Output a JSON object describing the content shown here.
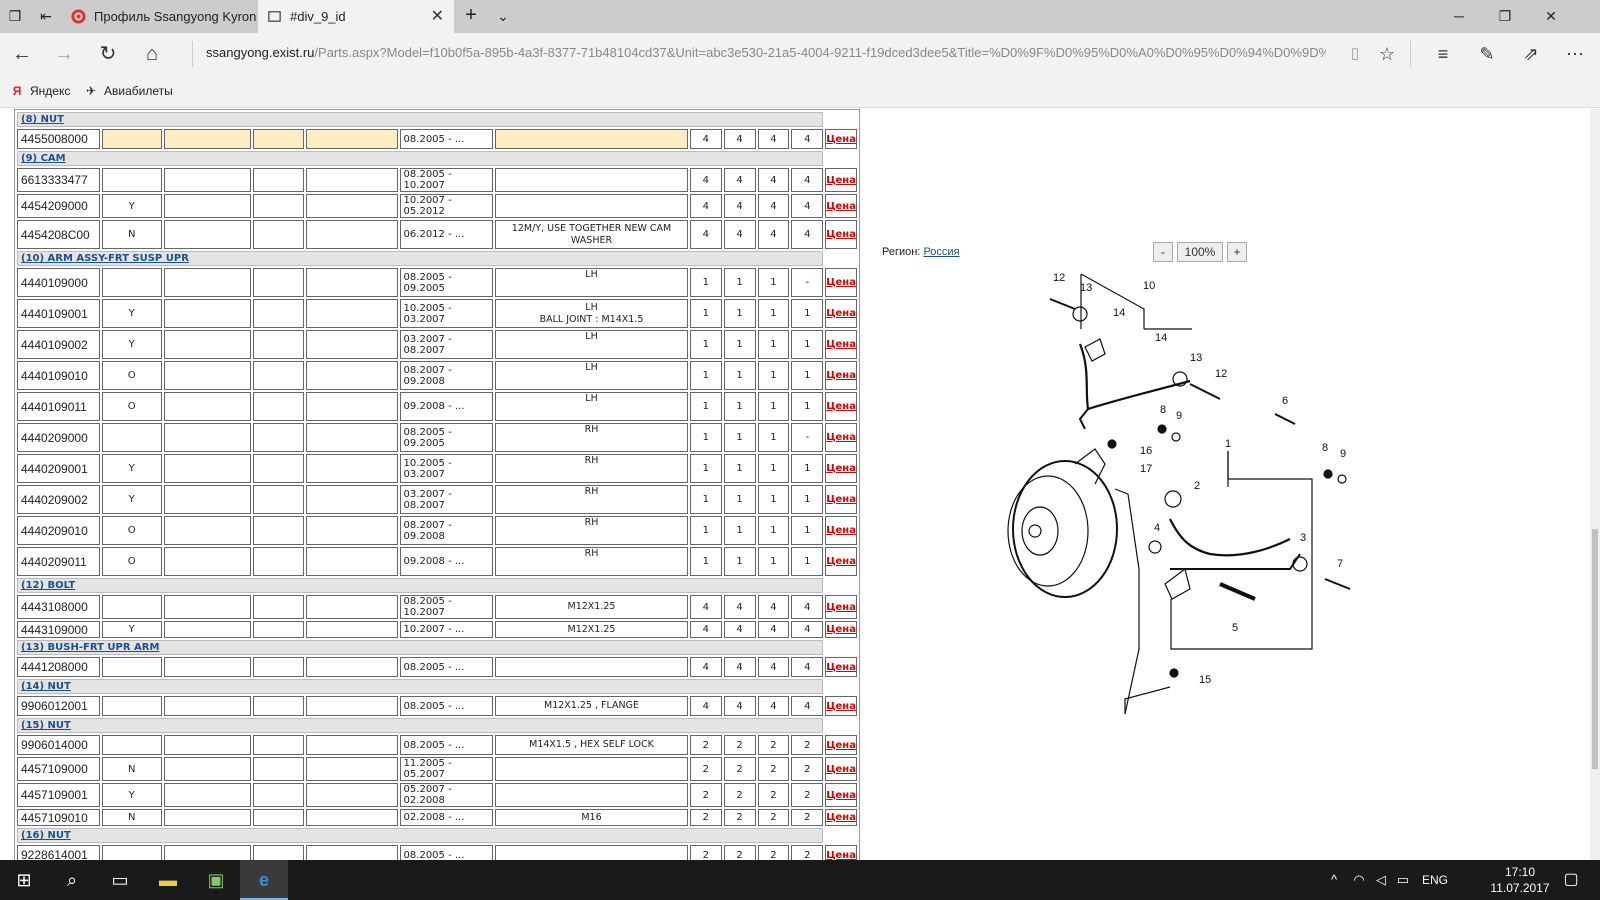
{
  "browser": {
    "tabs": [
      {
        "title": "Профиль Ssangyong Kyron",
        "active": false
      },
      {
        "title": "#div_9_id",
        "active": true
      }
    ],
    "url_host": "ssangyong.exist.ru",
    "url_path": "/Parts.aspx?Model=f10b0f5a-895b-4a3f-8377-71b48104cd37&Unit=abc3e530-21a5-4004-9211-f19dced3dee5&Title=%D0%9F%D0%95%D0%A0%D0%95%D0%94%D0%9D%D0",
    "favorites": [
      {
        "label": "Яндекс"
      },
      {
        "label": "Авиабилеты"
      }
    ]
  },
  "parts": {
    "price_label": "Цена",
    "groups": [
      {
        "header": "(8)    NUT",
        "rows": [
          {
            "pn": "4455008000",
            "c2": "",
            "date": "08.2005 - ...",
            "note": "",
            "q": [
              "4",
              "4",
              "4",
              "4"
            ],
            "hl": true,
            "h": 20
          }
        ]
      },
      {
        "header": "(9)    CAM",
        "rows": [
          {
            "pn": "6613333477",
            "c2": "",
            "date": "08.2005 - 10.2007",
            "note": "",
            "q": [
              "4",
              "4",
              "4",
              "4"
            ],
            "h": 20
          },
          {
            "pn": "4454209000",
            "c2": "Y",
            "date": "10.2007 - 05.2012",
            "note": "",
            "q": [
              "4",
              "4",
              "4",
              "4"
            ],
            "h": 20
          },
          {
            "pn": "4454208C00",
            "c2": "N",
            "date": "06.2012 - ...",
            "note": "12M/Y, USE TOGETHER NEW CAM WASHER",
            "q": [
              "4",
              "4",
              "4",
              "4"
            ],
            "h": 29
          }
        ]
      },
      {
        "header": "(10)    ARM ASSY-FRT SUSP UPR",
        "rows": [
          {
            "pn": "4440109000",
            "c2": "",
            "date": "08.2005 - 09.2005",
            "note": "LH",
            "q": [
              "1",
              "1",
              "1",
              "-"
            ],
            "h": 29,
            "top": true
          },
          {
            "pn": "4440109001",
            "c2": "Y",
            "date": "10.2005 - 03.2007",
            "note": "LH\nBALL JOINT : M14X1.5",
            "q": [
              "1",
              "1",
              "1",
              "1"
            ],
            "h": 29
          },
          {
            "pn": "4440109002",
            "c2": "Y",
            "date": "03.2007 - 08.2007",
            "note": "LH",
            "q": [
              "1",
              "1",
              "1",
              "1"
            ],
            "h": 29,
            "top": true
          },
          {
            "pn": "4440109010",
            "c2": "O",
            "date": "08.2007 - 09.2008",
            "note": "LH",
            "q": [
              "1",
              "1",
              "1",
              "1"
            ],
            "h": 29,
            "top": true
          },
          {
            "pn": "4440109011",
            "c2": "O",
            "date": "09.2008 - ...",
            "note": "LH",
            "q": [
              "1",
              "1",
              "1",
              "1"
            ],
            "h": 29,
            "top": true
          },
          {
            "pn": "4440209000",
            "c2": "",
            "date": "08.2005 - 09.2005",
            "note": "RH",
            "q": [
              "1",
              "1",
              "1",
              "-"
            ],
            "h": 29,
            "top": true
          },
          {
            "pn": "4440209001",
            "c2": "Y",
            "date": "10.2005 - 03.2007",
            "note": "RH",
            "q": [
              "1",
              "1",
              "1",
              "1"
            ],
            "h": 29,
            "top": true
          },
          {
            "pn": "4440209002",
            "c2": "Y",
            "date": "03.2007 - 08.2007",
            "note": "RH",
            "q": [
              "1",
              "1",
              "1",
              "1"
            ],
            "h": 29,
            "top": true
          },
          {
            "pn": "4440209010",
            "c2": "O",
            "date": "08.2007 - 09.2008",
            "note": "RH",
            "q": [
              "1",
              "1",
              "1",
              "1"
            ],
            "h": 29,
            "top": true
          },
          {
            "pn": "4440209011",
            "c2": "O",
            "date": "09.2008 - ...",
            "note": "RH",
            "q": [
              "1",
              "1",
              "1",
              "1"
            ],
            "h": 29,
            "top": true
          }
        ]
      },
      {
        "header": "(12)    BOLT",
        "rows": [
          {
            "pn": "4443108000",
            "c2": "",
            "date": "08.2005 - 10.2007",
            "note": "M12X1.25",
            "q": [
              "4",
              "4",
              "4",
              "4"
            ],
            "h": 17
          },
          {
            "pn": "4443109000",
            "c2": "Y",
            "date": "10.2007 - ...",
            "note": "M12X1.25",
            "q": [
              "4",
              "4",
              "4",
              "4"
            ],
            "h": 17
          }
        ]
      },
      {
        "header": "(13)    BUSH-FRT UPR ARM",
        "rows": [
          {
            "pn": "4441208000",
            "c2": "",
            "date": "08.2005 - ...",
            "note": "",
            "q": [
              "4",
              "4",
              "4",
              "4"
            ],
            "h": 20
          }
        ]
      },
      {
        "header": "(14)    NUT",
        "rows": [
          {
            "pn": "9906012001",
            "c2": "",
            "date": "08.2005 - ...",
            "note": "M12X1.25 , FLANGE",
            "q": [
              "4",
              "4",
              "4",
              "4"
            ],
            "h": 20
          }
        ]
      },
      {
        "header": "(15)    NUT",
        "rows": [
          {
            "pn": "9906014000",
            "c2": "",
            "date": "08.2005 - ...",
            "note": "M14X1.5 , HEX SELF LOCK",
            "q": [
              "2",
              "2",
              "2",
              "2"
            ],
            "h": 20
          },
          {
            "pn": "4457109000",
            "c2": "N",
            "date": "11.2005 - 05.2007",
            "note": "",
            "q": [
              "2",
              "2",
              "2",
              "2"
            ],
            "h": 17
          },
          {
            "pn": "4457109001",
            "c2": "Y",
            "date": "05.2007 - 02.2008",
            "note": "",
            "q": [
              "2",
              "2",
              "2",
              "2"
            ],
            "h": 17
          },
          {
            "pn": "4457109010",
            "c2": "N",
            "date": "02.2008 - ...",
            "note": "M16",
            "q": [
              "2",
              "2",
              "2",
              "2"
            ],
            "h": 17
          }
        ]
      },
      {
        "header": "(16)    NUT",
        "rows": [
          {
            "pn": "9228614001",
            "c2": "",
            "date": "08.2005 - ...",
            "note": "",
            "q": [
              "2",
              "2",
              "2",
              "2"
            ],
            "h": 20
          }
        ]
      }
    ]
  },
  "viewer": {
    "region_label": "Регион:",
    "region_value": "Россия",
    "zoom_minus": "-",
    "zoom_value": "100%",
    "zoom_plus": "+",
    "callouts": [
      "12",
      "13",
      "10",
      "14",
      "14",
      "13",
      "12",
      "6",
      "8",
      "9",
      "1",
      "16",
      "17",
      "8",
      "9",
      "2",
      "4",
      "3",
      "7",
      "5",
      "15"
    ]
  },
  "taskbar": {
    "lang": "ENG",
    "time": "17:10",
    "date": "11.07.2017"
  }
}
